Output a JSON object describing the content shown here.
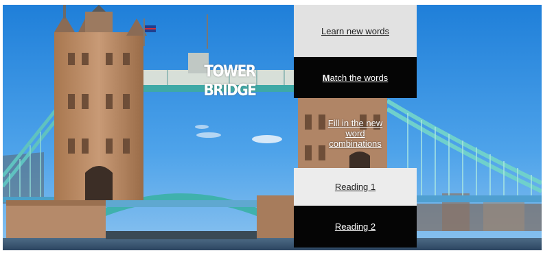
{
  "scene": {
    "title": "TOWER BRIDGE",
    "image_icon": "tower-bridge-photo",
    "colors": {
      "sky": "#2f8fe0",
      "stone": "#b98a67",
      "teal": "#4fb4ad",
      "water": "#3a5a78"
    }
  },
  "menu": {
    "items": [
      {
        "label": "Learn new words"
      },
      {
        "label": "Match the words",
        "first_letter": "M",
        "rest": "atch the words"
      },
      {
        "label": "Fill in the new word combinations"
      },
      {
        "label": "Reading 1"
      },
      {
        "label": "Reading 2"
      }
    ]
  }
}
